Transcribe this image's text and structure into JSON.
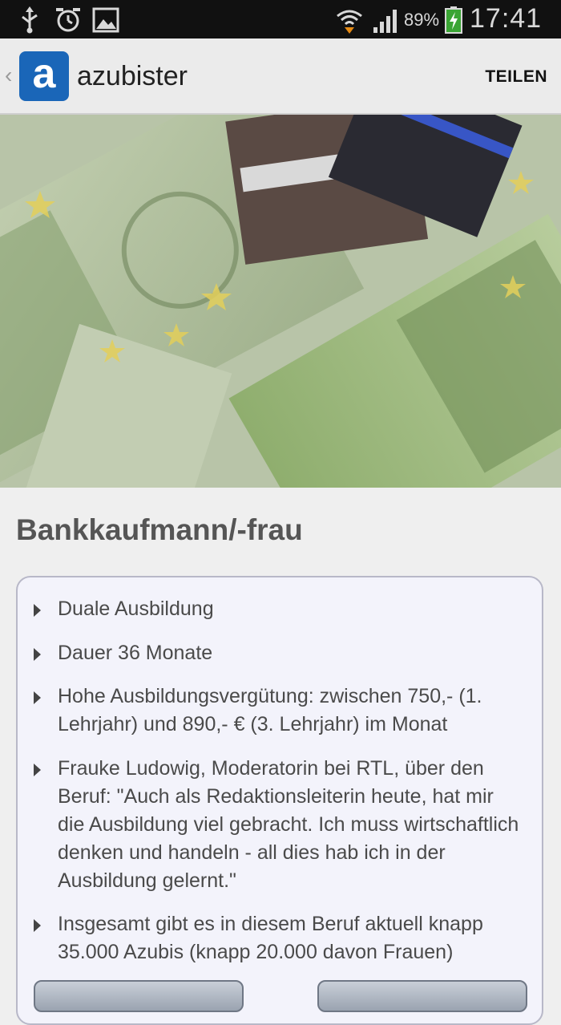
{
  "statusbar": {
    "battery": "89%",
    "time": "17:41"
  },
  "actionbar": {
    "app_name": "azubister",
    "logo_letter": "a",
    "share_label": "TEILEN"
  },
  "job": {
    "title": "Bankkaufmann/-frau",
    "bullets": [
      "Duale Ausbildung",
      "Dauer 36 Monate",
      "Hohe Ausbildungsvergütung: zwischen 750,- (1. Lehrjahr) und 890,- € (3. Lehrjahr) im Monat",
      "Frauke Ludowig, Moderatorin bei RTL, über den Beruf: \"Auch als Redaktionsleiterin heute, hat mir die Ausbildung viel gebracht. Ich muss wirtschaftlich denken und handeln - all dies hab ich in der Ausbildung gelernt.\"",
      "Insgesamt gibt es in diesem Beruf aktuell knapp 35.000 Azubis (knapp 20.000 davon Frauen)"
    ]
  },
  "colors": {
    "brand": "#1a66b8",
    "statusbar_bg": "#111111",
    "card_bg": "#f3f3fb"
  }
}
